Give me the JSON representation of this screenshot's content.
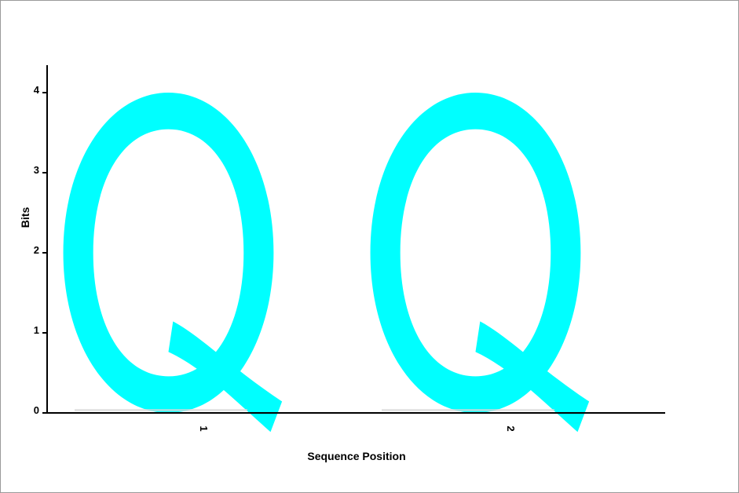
{
  "chart_data": {
    "type": "sequence-logo",
    "xlabel": "Sequence Position",
    "ylabel": "Bits",
    "ylim": [
      0,
      4
    ],
    "yticks": [
      "0",
      "1",
      "2",
      "3",
      "4"
    ],
    "positions": [
      {
        "label": "1",
        "letters": [
          {
            "letter": "Q",
            "bits": 4.0,
            "color": "#00ffff"
          }
        ]
      },
      {
        "label": "2",
        "letters": [
          {
            "letter": "Q",
            "bits": 4.0,
            "color": "#00ffff"
          }
        ]
      }
    ]
  }
}
